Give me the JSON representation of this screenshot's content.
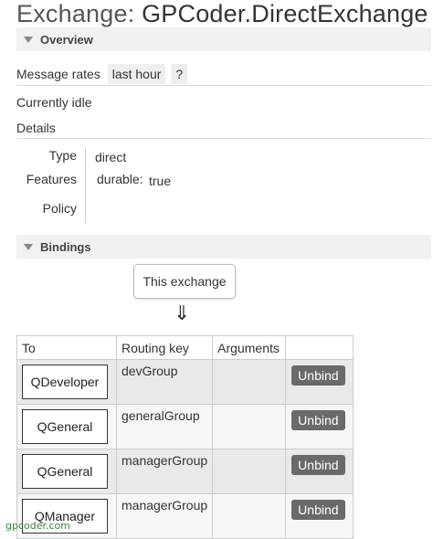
{
  "page": {
    "title_prefix": "Exchange: ",
    "title_name": "GPCoder.DirectExchange"
  },
  "overview": {
    "header": "Overview",
    "message_rates_label": "Message rates",
    "message_rates_period": "last hour",
    "help": "?",
    "status": "Currently idle",
    "details_label": "Details",
    "type_label": "Type",
    "type_value": "direct",
    "features_label": "Features",
    "features_key": "durable:",
    "features_value": "true",
    "policy_label": "Policy"
  },
  "bindings": {
    "header": "Bindings",
    "source_label": "This exchange",
    "arrow": "⇓",
    "columns": [
      "To",
      "Routing key",
      "Arguments",
      ""
    ],
    "rows": [
      {
        "to": "QDeveloper",
        "routing_key": "devGroup",
        "arguments": "",
        "action": "Unbind"
      },
      {
        "to": "QGeneral",
        "routing_key": "generalGroup",
        "arguments": "",
        "action": "Unbind"
      },
      {
        "to": "QGeneral",
        "routing_key": "managerGroup",
        "arguments": "",
        "action": "Unbind"
      },
      {
        "to": "QManager",
        "routing_key": "managerGroup",
        "arguments": "",
        "action": "Unbind"
      }
    ]
  },
  "watermark": "gpcoder.com"
}
